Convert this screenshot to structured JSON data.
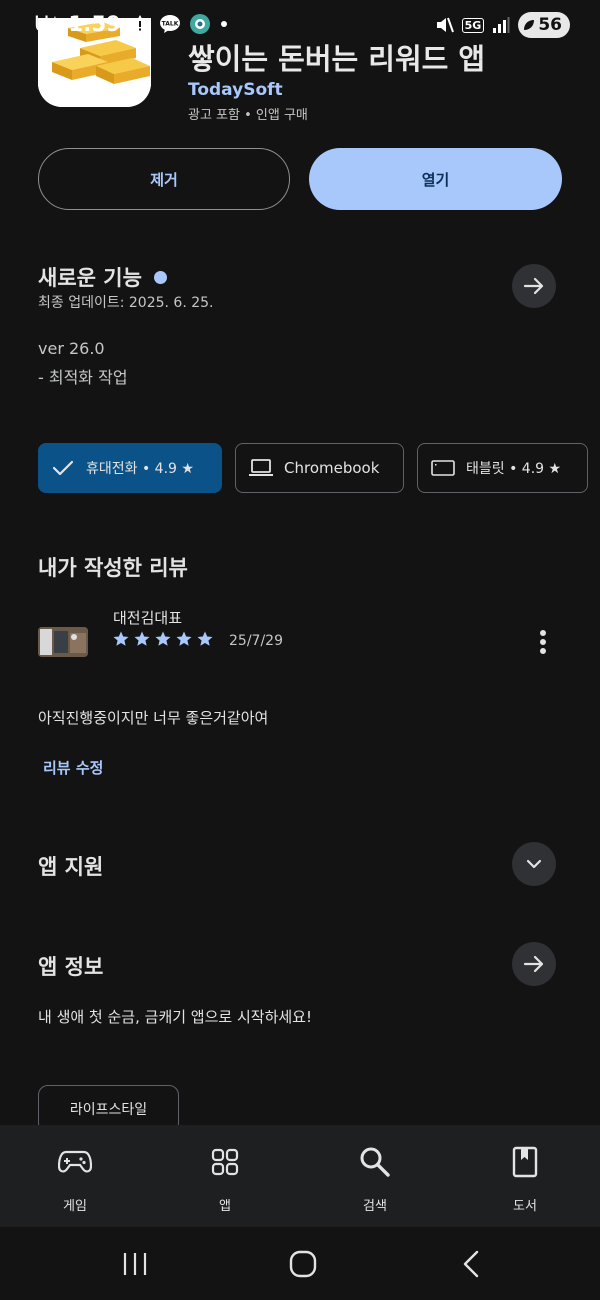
{
  "status_bar": {
    "carrier": "U⁺",
    "time": "1:59",
    "talk_badge": "TALK",
    "network": "5G",
    "battery": "56"
  },
  "app": {
    "title": "쌓이는 돈버는 리워드 앱",
    "developer": "TodaySoft",
    "meta": "광고 포함 • 인앱 구매"
  },
  "actions": {
    "uninstall_label": "제거",
    "open_label": "열기"
  },
  "whats_new": {
    "title": "새로운 기능",
    "last_updated": "최종 업데이트: 2025. 6. 25.",
    "version": "ver 26.0",
    "note": "- 최적화 작업"
  },
  "device_chips": [
    {
      "label": "휴대전화 • 4.9 ★",
      "selected": true
    },
    {
      "label": "Chromebook",
      "selected": false
    },
    {
      "label": "태블릿 • 4.9 ★",
      "selected": false
    }
  ],
  "my_review": {
    "title": "내가 작성한 리뷰",
    "reviewer": "대전김대표",
    "rating": 5,
    "date": "25/7/29",
    "text": "아직진행중이지만 너무 좋은거같아여",
    "edit_label": "리뷰 수정"
  },
  "app_support": {
    "title": "앱 지원"
  },
  "app_info": {
    "title": "앱 정보",
    "description": "내 생애 첫 순금, 금캐기 앱으로 시작하세요!",
    "category": "라이프스타일"
  },
  "bottom_nav": {
    "items": [
      {
        "label": "게임",
        "icon": "gamepad-icon"
      },
      {
        "label": "앱",
        "icon": "apps-grid-icon"
      },
      {
        "label": "검색",
        "icon": "search-icon"
      },
      {
        "label": "도서",
        "icon": "book-icon"
      }
    ]
  },
  "colors": {
    "background": "#131313",
    "accent": "#a8c7fa",
    "selected_chip": "#0b5288",
    "star": "#a8c7fa"
  }
}
